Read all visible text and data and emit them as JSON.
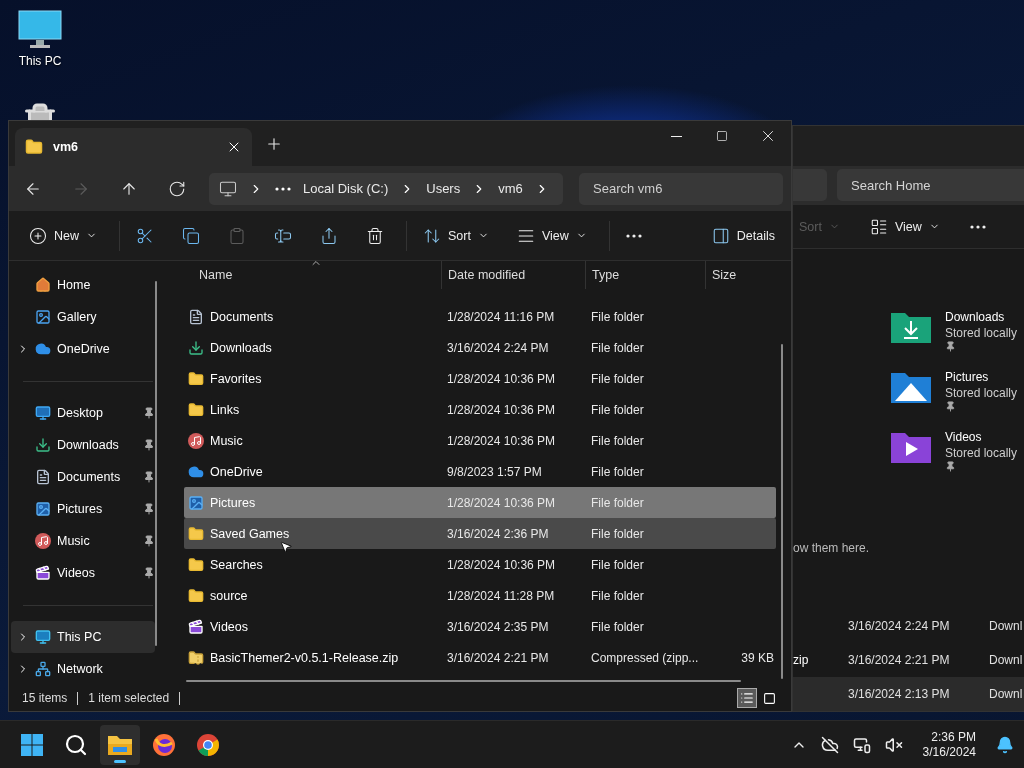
{
  "desktop": {
    "icons": [
      {
        "kind": "monitor",
        "label": "This PC"
      },
      {
        "kind": "recycle-bin"
      }
    ]
  },
  "background_window": {
    "search": {
      "placeholder": "Search Home"
    },
    "toolbar": [
      {
        "kind": "sort",
        "label": "Sort",
        "disabled": true
      },
      {
        "kind": "view",
        "label": "View",
        "disabled": false
      },
      {
        "kind": "more",
        "disabled": false
      }
    ],
    "quick_access": [
      {
        "kind": "downloads",
        "name": "Downloads",
        "status": "Stored locally",
        "pinned": true
      },
      {
        "kind": "pictures",
        "name": "Pictures",
        "status": "Stored locally",
        "pinned": true
      },
      {
        "kind": "videos",
        "name": "Videos",
        "status": "Stored locally",
        "pinned": true
      }
    ],
    "hint": "ow them here.",
    "recent": [
      {
        "date": "3/16/2024 2:24 PM",
        "location": "Downl",
        "selected": false
      },
      {
        "name": "zip",
        "date": "3/16/2024 2:21 PM",
        "location": "Downl",
        "selected": false
      },
      {
        "date": "3/16/2024 2:13 PM",
        "location": "Downl",
        "selected": true
      }
    ]
  },
  "window": {
    "tab": {
      "title": "vm6"
    },
    "nav": [
      {
        "kind": "back",
        "disabled": false
      },
      {
        "kind": "forward",
        "disabled": true
      },
      {
        "kind": "up",
        "disabled": false
      },
      {
        "kind": "refresh",
        "disabled": false
      }
    ],
    "breadcrumb": [
      "Local Disk (C:)",
      "Users",
      "vm6"
    ],
    "search": {
      "placeholder": "Search vm6"
    },
    "toolbar": [
      {
        "kind": "new",
        "label": "New",
        "disabled": false
      },
      {
        "kind": "cut",
        "disabled": false
      },
      {
        "kind": "copy",
        "disabled": false
      },
      {
        "kind": "paste",
        "disabled": true
      },
      {
        "kind": "rename",
        "disabled": false
      },
      {
        "kind": "share",
        "disabled": false
      },
      {
        "kind": "delete",
        "disabled": false
      },
      {
        "kind": "sort",
        "label": "Sort",
        "disabled": false
      },
      {
        "kind": "view",
        "label": "View",
        "disabled": false
      },
      {
        "kind": "more",
        "disabled": false
      }
    ],
    "details_button": "Details",
    "sidebar": [
      [
        {
          "kind": "home",
          "label": "Home",
          "expandable": false,
          "pinned": false,
          "selected": false
        },
        {
          "kind": "gallery",
          "label": "Gallery",
          "expandable": false,
          "pinned": false,
          "selected": false
        },
        {
          "kind": "onedrive",
          "label": "OneDrive",
          "expandable": true,
          "pinned": false,
          "selected": false
        }
      ],
      [
        {
          "kind": "desktop",
          "label": "Desktop",
          "expandable": false,
          "pinned": true,
          "selected": false
        },
        {
          "kind": "downloads",
          "label": "Downloads",
          "expandable": false,
          "pinned": true,
          "selected": false
        },
        {
          "kind": "documents",
          "label": "Documents",
          "expandable": false,
          "pinned": true,
          "selected": false
        },
        {
          "kind": "pictures",
          "label": "Pictures",
          "expandable": false,
          "pinned": true,
          "selected": false
        },
        {
          "kind": "music",
          "label": "Music",
          "expandable": false,
          "pinned": true,
          "selected": false
        },
        {
          "kind": "videos",
          "label": "Videos",
          "expandable": false,
          "pinned": true,
          "selected": false
        }
      ],
      [
        {
          "kind": "thispc",
          "label": "This PC",
          "expandable": true,
          "pinned": false,
          "selected": true
        },
        {
          "kind": "network",
          "label": "Network",
          "expandable": true,
          "pinned": false,
          "selected": false
        }
      ]
    ],
    "table": {
      "columns": [
        {
          "label": "Name",
          "sorted": true
        },
        {
          "label": "Date modified",
          "sorted": false
        },
        {
          "label": "Type",
          "sorted": false
        },
        {
          "label": "Size",
          "sorted": false
        }
      ],
      "rows": [
        {
          "kind": "documents",
          "name": "Documents",
          "date": "1/28/2024 11:16 PM",
          "type": "File folder",
          "selected": false,
          "hovered": false
        },
        {
          "kind": "downloads",
          "name": "Downloads",
          "date": "3/16/2024 2:24 PM",
          "type": "File folder",
          "selected": false,
          "hovered": false
        },
        {
          "kind": "folder",
          "name": "Favorites",
          "date": "1/28/2024 10:36 PM",
          "type": "File folder",
          "selected": false,
          "hovered": false
        },
        {
          "kind": "folder",
          "name": "Links",
          "date": "1/28/2024 10:36 PM",
          "type": "File folder",
          "selected": false,
          "hovered": false
        },
        {
          "kind": "music",
          "name": "Music",
          "date": "1/28/2024 10:36 PM",
          "type": "File folder",
          "selected": false,
          "hovered": false
        },
        {
          "kind": "onedrive",
          "name": "OneDrive",
          "date": "9/8/2023 1:57 PM",
          "type": "File folder",
          "selected": false,
          "hovered": false
        },
        {
          "kind": "pictures",
          "name": "Pictures",
          "date": "1/28/2024 10:36 PM",
          "type": "File folder",
          "selected": true,
          "hovered": false
        },
        {
          "kind": "folder",
          "name": "Saved Games",
          "date": "3/16/2024 2:36 PM",
          "type": "File folder",
          "selected": false,
          "hovered": true
        },
        {
          "kind": "folder",
          "name": "Searches",
          "date": "1/28/2024 10:36 PM",
          "type": "File folder",
          "selected": false,
          "hovered": false
        },
        {
          "kind": "folder",
          "name": "source",
          "date": "1/28/2024 11:28 PM",
          "type": "File folder",
          "selected": false,
          "hovered": false
        },
        {
          "kind": "videos",
          "name": "Videos",
          "date": "3/16/2024 2:35 PM",
          "type": "File folder",
          "selected": false,
          "hovered": false
        },
        {
          "kind": "zip",
          "name": "BasicThemer2-v0.5.1-Release.zip",
          "date": "3/16/2024 2:21 PM",
          "type": "Compressed (zipp...",
          "size": "39 KB",
          "selected": false,
          "hovered": false
        }
      ]
    },
    "status_bar": {
      "count": "15 items",
      "selection": "1 item selected"
    },
    "view_buttons": [
      {
        "kind": "details",
        "selected": true
      },
      {
        "kind": "tiles",
        "selected": false
      }
    ]
  },
  "taskbar": {
    "apps": [
      {
        "kind": "start",
        "active": false
      },
      {
        "kind": "search",
        "active": false
      },
      {
        "kind": "explorer",
        "active": true
      },
      {
        "kind": "firefox",
        "active": false
      },
      {
        "kind": "chrome",
        "active": false
      }
    ],
    "time": "2:36 PM",
    "date": "3/16/2024"
  }
}
